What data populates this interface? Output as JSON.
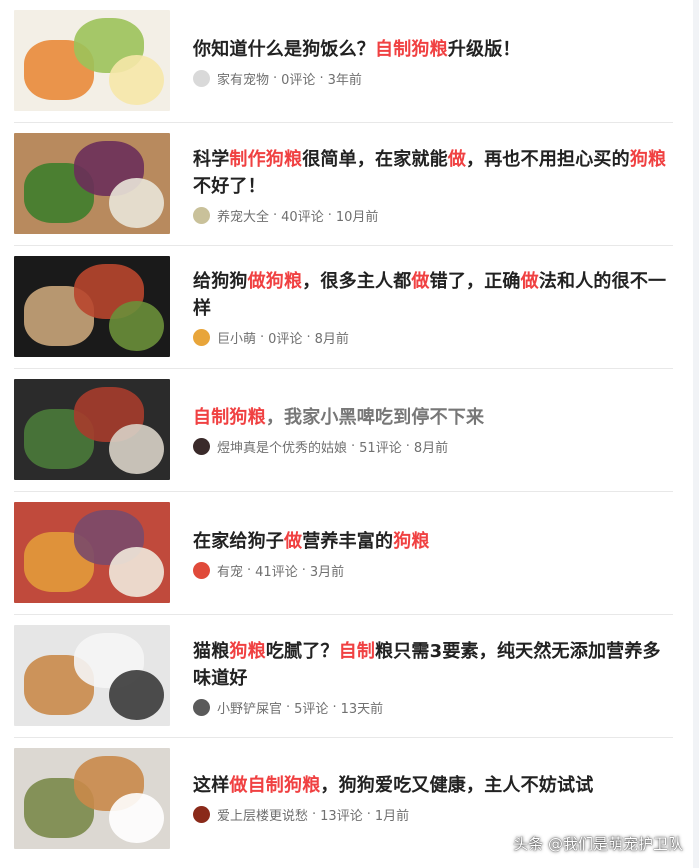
{
  "articles": [
    {
      "title_parts": [
        {
          "text": "你知道什么是狗饭么？",
          "hl": false
        },
        {
          "text": "自制狗粮",
          "hl": true
        },
        {
          "text": "升级版！",
          "hl": false
        }
      ],
      "source": "家有宠物",
      "comments": "0评论",
      "time": "3年前",
      "avatar_color": "#d9d9d9",
      "thumb_colors": [
        "#f3efe6",
        "#e98a3a",
        "#9cc25a",
        "#f6e7a8"
      ]
    },
    {
      "title_parts": [
        {
          "text": "科学",
          "hl": false
        },
        {
          "text": "制作狗粮",
          "hl": true
        },
        {
          "text": "很简单，在家就能",
          "hl": false
        },
        {
          "text": "做",
          "hl": true
        },
        {
          "text": "，再也不用担心买的",
          "hl": false
        },
        {
          "text": "狗粮",
          "hl": true
        },
        {
          "text": "不好了！",
          "hl": false
        }
      ],
      "source": "养宠大全",
      "comments": "40评论",
      "time": "10月前",
      "avatar_color": "#c9c19a",
      "thumb_colors": [
        "#b88a5e",
        "#3f7d2c",
        "#6b2f5a",
        "#e9e4d8"
      ]
    },
    {
      "title_parts": [
        {
          "text": "给狗狗",
          "hl": false
        },
        {
          "text": "做狗粮",
          "hl": true
        },
        {
          "text": "，很多主人都",
          "hl": false
        },
        {
          "text": "做",
          "hl": true
        },
        {
          "text": "错了，正确",
          "hl": false
        },
        {
          "text": "做",
          "hl": true
        },
        {
          "text": "法和人的很不一样",
          "hl": false
        }
      ],
      "source": "巨小萌",
      "comments": "0评论",
      "time": "8月前",
      "avatar_color": "#e8a53a",
      "thumb_colors": [
        "#1a1a1a",
        "#c9a57a",
        "#b8462e",
        "#6a8f3a"
      ]
    },
    {
      "title_parts": [
        {
          "text": "自制狗粮",
          "hl": true
        },
        {
          "text": "，我家小黑啤吃到停不下来",
          "hl": false,
          "grey": true
        }
      ],
      "source": "煜坤真是个优秀的姑娘",
      "comments": "51评论",
      "time": "8月前",
      "avatar_color": "#3a2a2a",
      "thumb_colors": [
        "#2b2b2b",
        "#4a7a3a",
        "#a63c2c",
        "#d8d2c6"
      ]
    },
    {
      "title_parts": [
        {
          "text": "在家给狗子",
          "hl": false
        },
        {
          "text": "做",
          "hl": true
        },
        {
          "text": "营养丰富的",
          "hl": false
        },
        {
          "text": "狗粮",
          "hl": true
        }
      ],
      "source": "有宠",
      "comments": "41评论",
      "time": "3月前",
      "avatar_color": "#e04a3a",
      "thumb_colors": [
        "#c04a3c",
        "#e29a3a",
        "#7a4a6a",
        "#efe8da"
      ]
    },
    {
      "title_parts": [
        {
          "text": "猫粮",
          "hl": false
        },
        {
          "text": "狗粮",
          "hl": true
        },
        {
          "text": "吃腻了？",
          "hl": false
        },
        {
          "text": "自制",
          "hl": true
        },
        {
          "text": "粮只需3要素，纯天然无添加营养多味道好",
          "hl": false
        }
      ],
      "source": "小野铲屎官",
      "comments": "5评论",
      "time": "13天前",
      "avatar_color": "#5a5a5a",
      "thumb_colors": [
        "#e6e6e6",
        "#c98a4a",
        "#f5f5f5",
        "#3a3a3a"
      ]
    },
    {
      "title_parts": [
        {
          "text": "这样",
          "hl": false
        },
        {
          "text": "做自制狗粮",
          "hl": true
        },
        {
          "text": "，狗狗爱吃又健康，主人不妨试试",
          "hl": false
        }
      ],
      "source": "爱上层楼更说愁",
      "comments": "13评论",
      "time": "1月前",
      "avatar_color": "#8a2a1a",
      "thumb_colors": [
        "#dcd8d2",
        "#7a8a4a",
        "#c98a4a",
        "#ffffff"
      ]
    }
  ],
  "watermark": "头条 @我们是萌宠护卫队"
}
